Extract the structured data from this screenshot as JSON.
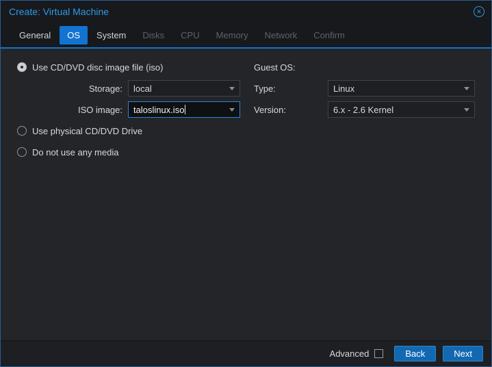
{
  "window": {
    "title": "Create: Virtual Machine"
  },
  "tabs": [
    {
      "label": "General",
      "state": "enabled"
    },
    {
      "label": "OS",
      "state": "active"
    },
    {
      "label": "System",
      "state": "enabled"
    },
    {
      "label": "Disks",
      "state": "disabled"
    },
    {
      "label": "CPU",
      "state": "disabled"
    },
    {
      "label": "Memory",
      "state": "disabled"
    },
    {
      "label": "Network",
      "state": "disabled"
    },
    {
      "label": "Confirm",
      "state": "disabled"
    }
  ],
  "form": {
    "media": {
      "radio_iso": {
        "label": "Use CD/DVD disc image file (iso)",
        "checked": true
      },
      "storage": {
        "label": "Storage:",
        "value": "local"
      },
      "iso_image": {
        "label": "ISO image:",
        "value": "taloslinux.iso",
        "focused": true
      },
      "radio_physical": {
        "label": "Use physical CD/DVD Drive",
        "checked": false
      },
      "radio_none": {
        "label": "Do not use any media",
        "checked": false
      }
    },
    "guest_os": {
      "header": "Guest OS:",
      "type": {
        "label": "Type:",
        "value": "Linux"
      },
      "version": {
        "label": "Version:",
        "value": "6.x - 2.6 Kernel"
      }
    }
  },
  "footer": {
    "advanced_label": "Advanced",
    "advanced_checked": false,
    "back_label": "Back",
    "next_label": "Next"
  },
  "colors": {
    "accent_blue": "#1373d1",
    "title_blue": "#2e9be6",
    "button_blue": "#1269b2",
    "focus_border": "#2e85e0",
    "header_background": "#17191d",
    "panel_background": "#232529",
    "field_background": "#1d1f23",
    "text": "#d7d9db",
    "disabled_text": "#5e6266"
  }
}
